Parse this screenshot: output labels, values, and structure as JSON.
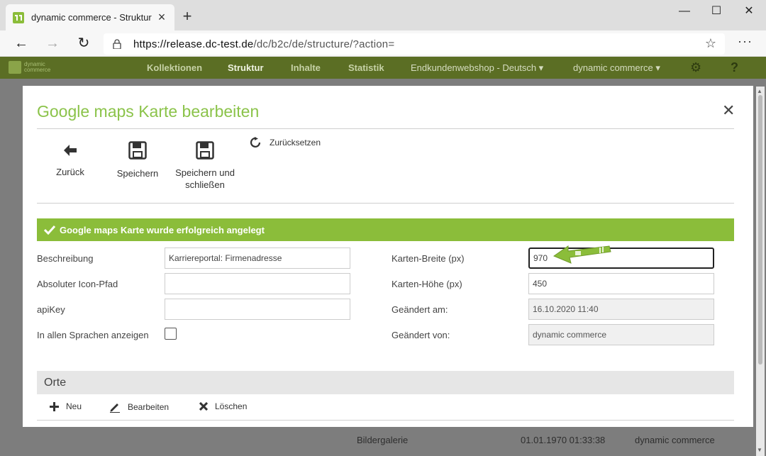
{
  "browser": {
    "tab_title": "dynamic commerce - Struktur",
    "url_host": "https://release.dc-test.de",
    "url_path": "/dc/b2c/de/structure/?action="
  },
  "app": {
    "logo_text_1": "dynamic",
    "logo_text_2": "commerce",
    "nav": [
      "Kollektionen",
      "Struktur",
      "Inhalte",
      "Statistik"
    ],
    "shop_select": "Endkundenwebshop - Deutsch",
    "user_select": "dynamic commerce"
  },
  "background_rows": [
    {
      "name": "Bildergalerie",
      "date": "01.01.1970 01:33:38",
      "user": "dynamic commerce"
    }
  ],
  "modal": {
    "title": "Google maps Karte bearbeiten",
    "toolbar": {
      "back_label": "Zurück",
      "save_label": "Speichern",
      "save_close_label": "Speichern und schließen",
      "reset_label": "Zurücksetzen"
    },
    "success_message": "Google maps Karte wurde erfolgreich angelegt",
    "fields_left": {
      "description_label": "Beschreibung",
      "description_value": "Karriereportal: Firmenadresse",
      "icon_path_label": "Absoluter Icon-Pfad",
      "icon_path_value": "",
      "apikey_label": "apiKey",
      "apikey_value": "",
      "all_languages_label": "In allen Sprachen anzeigen",
      "all_languages_checked": false
    },
    "fields_right": {
      "width_label": "Karten-Breite (px)",
      "width_value": "970",
      "height_label": "Karten-Höhe (px)",
      "height_value": "450",
      "changed_at_label": "Geändert am:",
      "changed_at_value": "16.10.2020 11:40",
      "changed_by_label": "Geändert von:",
      "changed_by_value": "dynamic commerce"
    },
    "orte": {
      "title": "Orte",
      "new_label": "Neu",
      "edit_label": "Bearbeiten",
      "delete_label": "Löschen"
    }
  },
  "colors": {
    "accent_green": "#8bbd3a",
    "title_green": "#8bc34a",
    "app_header": "#5b6e24"
  }
}
